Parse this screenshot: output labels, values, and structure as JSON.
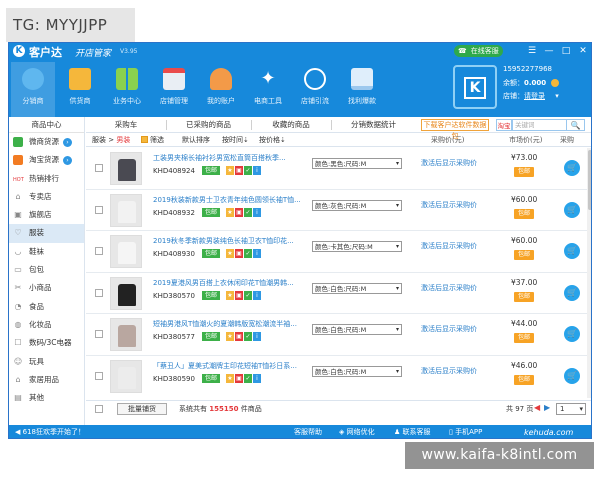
{
  "overlay_tag": "TG: MYYJJPP",
  "watermark": "www.kaifa-k8intl.com",
  "app": {
    "name": "客户达",
    "subtitle": "开店管家",
    "version": "V3.95",
    "online_label": "在线客服",
    "window_controls": [
      "☰",
      "—",
      "□",
      "✕"
    ]
  },
  "toolbar": [
    {
      "label": "分销商",
      "icon": "distributor-icon",
      "color": "#5fb7ef"
    },
    {
      "label": "供货商",
      "icon": "supplier-box-icon",
      "color": "#f5b73b"
    },
    {
      "label": "业务中心",
      "icon": "grid-icon",
      "color": "#8ad14f"
    },
    {
      "label": "店铺管理",
      "icon": "shop-icon",
      "color": "#e9eef4"
    },
    {
      "label": "我的账户",
      "icon": "account-icon",
      "color": "#f39a48"
    },
    {
      "label": "电商工具",
      "icon": "tools-icon",
      "color": "#ffffff"
    },
    {
      "label": "店铺引流",
      "icon": "traffic-icon",
      "color": "#ffffff"
    },
    {
      "label": "找利爆款",
      "icon": "monitor-icon",
      "color": "#dfeefb"
    }
  ],
  "account": {
    "phone": "15952277968",
    "balance_label": "余额：",
    "balance_value": "0.000",
    "shop_label": "店铺：",
    "shop_value": "请登录"
  },
  "sidebar": {
    "header": "商品中心",
    "items": [
      {
        "label": "微商货源",
        "icon": "wechat-icon",
        "color": "#3db049",
        "arrow": true
      },
      {
        "label": "淘宝货源",
        "icon": "taobao-icon",
        "color": "#f27b22",
        "arrow": true
      },
      {
        "label": "热销排行",
        "icon": "hot-icon",
        "glyph": "HOT"
      },
      {
        "label": "专卖店",
        "icon": "store-icon",
        "glyph": "⌂"
      },
      {
        "label": "旗舰店",
        "icon": "flag-icon",
        "glyph": "▣"
      },
      {
        "label": "服装",
        "icon": "clothing-icon",
        "glyph": "♡",
        "active": true
      },
      {
        "label": "鞋袜",
        "icon": "shoe-icon",
        "glyph": "◡"
      },
      {
        "label": "包包",
        "icon": "bag-icon",
        "glyph": "▭"
      },
      {
        "label": "小商品",
        "icon": "scissors-icon",
        "glyph": "✂"
      },
      {
        "label": "食品",
        "icon": "food-icon",
        "glyph": "◔"
      },
      {
        "label": "化妆品",
        "icon": "cosmetics-icon",
        "glyph": "◍"
      },
      {
        "label": "数码/3C电器",
        "icon": "digital-icon",
        "glyph": "☐"
      },
      {
        "label": "玩具",
        "icon": "toy-icon",
        "glyph": "☺"
      },
      {
        "label": "家居用品",
        "icon": "home-icon",
        "glyph": "⌂"
      },
      {
        "label": "其他",
        "icon": "other-icon",
        "glyph": "▤"
      }
    ]
  },
  "tabs": {
    "items": [
      "采购车",
      "已采购的商品",
      "收藏的商品",
      "分销数据统计"
    ],
    "download_btn": "下载客户达软件数据包",
    "search_scope": "淘宝",
    "search_placeholder": "关键词",
    "search_btn": "🔍"
  },
  "filter": {
    "category_prefix": "服装",
    "category_sep": ">",
    "category_current": "男装",
    "filter_label": "筛选",
    "default_sort": "默认排序",
    "by_time": "按时间",
    "by_price": "按价格",
    "col_purchase_price": "采购价(元)",
    "col_market_price": "市场价(元)",
    "col_purchase": "采购"
  },
  "products": [
    {
      "title": "工装男夹棉长袖衬衫男宽松直筒百搭秋季...",
      "code": "KHD408924",
      "tag": "包邮",
      "sku": "颜色:黑色;尺码:M",
      "buy": "激活后显示采购价",
      "price": "¥73.00",
      "badge": "包邮",
      "shirt": "#4a4a52"
    },
    {
      "title": "2019秋装新款男士卫衣青年纯色圆领长袖T恤...",
      "code": "KHD408932",
      "tag": "包邮",
      "sku": "颜色:灰色;尺码:M",
      "buy": "激活后显示采购价",
      "price": "¥60.00",
      "badge": "包邮",
      "shirt": "#f2f2f2"
    },
    {
      "title": "2019秋冬季新款男装纯色长袖卫衣T恤印花...",
      "code": "KHD408930",
      "tag": "包邮",
      "sku": "颜色:卡其色;尺码:M",
      "buy": "激活后显示采购价",
      "price": "¥60.00",
      "badge": "包邮",
      "shirt": "#f5f5f5"
    },
    {
      "title": "2019夏港风男百搭上衣休闲印花T恤潮男韩...",
      "code": "KHD380570",
      "tag": "包邮",
      "sku": "颜色:白色;尺码:M",
      "buy": "激活后显示采购价",
      "price": "¥37.00",
      "badge": "包邮",
      "shirt": "#222222"
    },
    {
      "title": "短袖男港风T恤潮火的夏潮韩版宽松潮流半袖...",
      "code": "KHD380577",
      "tag": "包邮",
      "sku": "颜色:白色;尺码:M",
      "buy": "激活后显示采购价",
      "price": "¥44.00",
      "badge": "包邮",
      "shirt": "#b9a7a0"
    },
    {
      "title": "「蔡丑人」夏美式潮牌主印花短袖T恤衫日系...",
      "code": "KHD380590",
      "tag": "包邮",
      "sku": "颜色:白色;尺码:M",
      "buy": "激活后显示采购价",
      "price": "¥46.00",
      "badge": "包邮",
      "shirt": "#ececec"
    }
  ],
  "bottom": {
    "batch_btn": "批量铺货",
    "total_prefix": "系统共有",
    "total_count": "155150",
    "total_suffix": "件商品",
    "pages": "共 97 页",
    "page_prev": "◀",
    "page_next": "▶",
    "page_current": "1"
  },
  "statusbar": {
    "notice": "618狂欢季开始了！",
    "items": [
      "客服帮助",
      "网络优化",
      "联系客服",
      "手机APP"
    ],
    "site": "kehuda.com"
  }
}
